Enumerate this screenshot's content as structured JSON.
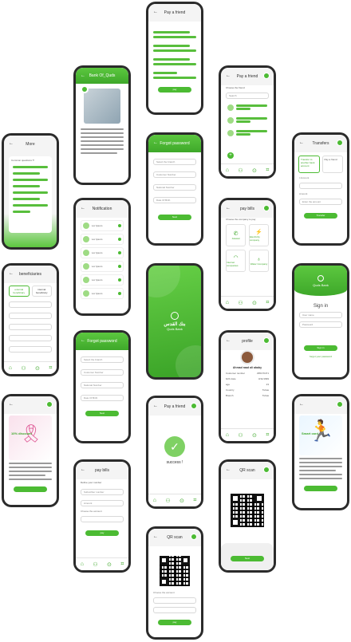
{
  "colors": {
    "brand": "#4cbb33",
    "brand_dark": "#3ea82a",
    "frame": "#2b2b2b",
    "screen_bg": "#f4f4f4"
  },
  "icons": {
    "back": "back-arrow-icon",
    "home": "home-icon",
    "profile": "user-icon",
    "location": "location-icon",
    "scan": "scan-icon",
    "qr": "qr-code-icon",
    "check": "check-icon"
  },
  "screens": {
    "pay_friend_top": {
      "title": "Pay a friend",
      "button": "pay"
    },
    "about": {
      "title": "Bank Of_Quds"
    },
    "pay_friend_choose": {
      "title": "Pay a friend",
      "heading": "Choose the friend",
      "search": "Search"
    },
    "more": {
      "title": "More",
      "item": "Common questions ?!"
    },
    "forgot_top": {
      "title": "Forgot password",
      "f1": "Select the branch",
      "f2": "Customer Number",
      "f3": "National Number",
      "f4": "Date Of Birth",
      "button": "Next"
    },
    "transfers": {
      "title": "Transfers",
      "opt1": "Transfer to another bank account",
      "opt2": "Pay a friend",
      "label1": "I Account",
      "label2": "Amount",
      "f": "Enter the amount",
      "button": "Transfer"
    },
    "beneficiaries": {
      "title": "beneficiaries",
      "tab1": "external beneficiary",
      "tab2": "internal beneficiary"
    },
    "notification": {
      "title": "Notification",
      "item": "Lor Ipsum"
    },
    "pay_bills_top": {
      "title": "pay bills",
      "heading": "Choose the company to pay",
      "t1": "Jawwal",
      "t2": "Electricity company",
      "t3": "Internet companies",
      "t4": "Water Company"
    },
    "splash": {
      "logo_ar": "بنك القدس",
      "logo_en": "Quds Bank"
    },
    "signin": {
      "title": "Sign in",
      "logo_en": "Quds Bank",
      "u": "User name",
      "p": "Password",
      "button": "Sign in",
      "forgot": "forgot your password"
    },
    "forgot_mid": {
      "title": "Forgot password",
      "f1": "Select the branch",
      "f2": "Customer Number",
      "f3": "National Number",
      "f4": "Date Of Birth",
      "button": "Next"
    },
    "profile": {
      "title": "profile",
      "name": "Ahmad raad ali ababy",
      "r1k": "Customer number",
      "r1v": "295176471",
      "r2k": "birth date",
      "r2v": "3/11/1999",
      "r3k": "age",
      "r3v": "23",
      "r4k": "Country",
      "r4v": "Tubas",
      "r5k": "Branch",
      "r5v": "Tubas"
    },
    "ad_left": {
      "promo": "10% discount"
    },
    "success": {
      "title": "Pay a friend",
      "msg": "success !"
    },
    "ad_right": {
      "promo": "Smart card"
    },
    "pay_bills_bottom": {
      "title": "pay bills",
      "heading": "Define your number",
      "f1": "Subscriber number",
      "f2": "Amount",
      "l": "Choose the account",
      "button": "pay"
    },
    "qr_right": {
      "title": "QR scan",
      "button": "Next"
    },
    "qr_bottom": {
      "title": "QR scan",
      "label": "Choose the account",
      "button": "pay"
    }
  }
}
